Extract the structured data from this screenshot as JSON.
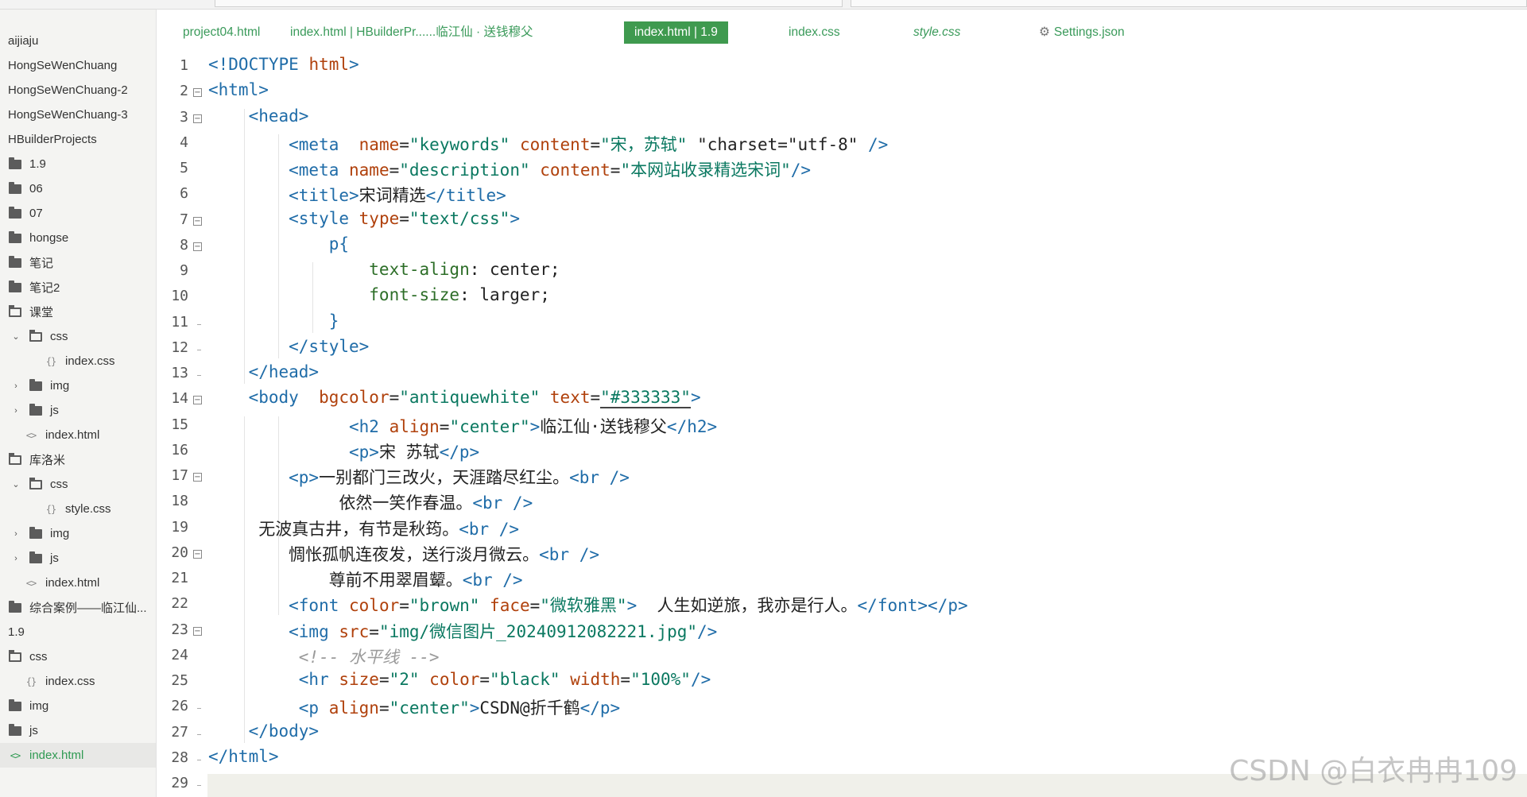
{
  "sidebar": {
    "items": [
      {
        "label": "aijiaju",
        "kind": "none",
        "chev": ""
      },
      {
        "label": "HongSeWenChuang",
        "kind": "none",
        "chev": ""
      },
      {
        "label": "HongSeWenChuang-2",
        "kind": "none",
        "chev": ""
      },
      {
        "label": "HongSeWenChuang-3",
        "kind": "none",
        "chev": ""
      },
      {
        "label": "HBuilderProjects",
        "kind": "none",
        "chev": ""
      },
      {
        "label": "1.9",
        "kind": "folder",
        "chev": ""
      },
      {
        "label": "06",
        "kind": "folder",
        "chev": ""
      },
      {
        "label": "07",
        "kind": "folder",
        "chev": ""
      },
      {
        "label": "hongse",
        "kind": "folder",
        "chev": ""
      },
      {
        "label": "笔记",
        "kind": "folder",
        "chev": ""
      },
      {
        "label": "笔记2",
        "kind": "folder",
        "chev": ""
      },
      {
        "label": "课堂",
        "kind": "folder-open",
        "chev": ""
      },
      {
        "label": "css",
        "kind": "folder-open",
        "chev": "v"
      },
      {
        "label": "index.css",
        "kind": "css",
        "chev": ""
      },
      {
        "label": "img",
        "kind": "folder",
        "chev": ">"
      },
      {
        "label": "js",
        "kind": "folder",
        "chev": ">"
      },
      {
        "label": "index.html",
        "kind": "html",
        "chev": ""
      },
      {
        "label": "库洛米",
        "kind": "folder-open",
        "chev": ""
      },
      {
        "label": "css",
        "kind": "folder-open",
        "chev": "v"
      },
      {
        "label": "style.css",
        "kind": "css",
        "chev": ""
      },
      {
        "label": "img",
        "kind": "folder",
        "chev": ">"
      },
      {
        "label": "js",
        "kind": "folder",
        "chev": ">"
      },
      {
        "label": "index.html",
        "kind": "html",
        "chev": ""
      },
      {
        "label": "综合案例——临江仙...",
        "kind": "folder",
        "chev": ""
      },
      {
        "label": "1.9",
        "kind": "none",
        "chev": ""
      },
      {
        "label": "css",
        "kind": "folder-open",
        "chev": ""
      },
      {
        "label": "index.css",
        "kind": "css",
        "chev": ""
      },
      {
        "label": "img",
        "kind": "folder",
        "chev": ""
      },
      {
        "label": "js",
        "kind": "folder",
        "chev": ""
      },
      {
        "label": "index.html",
        "kind": "html",
        "chev": "",
        "active": true
      }
    ]
  },
  "tabs": [
    {
      "label": "project04.html",
      "active": false
    },
    {
      "label": "index.html | HBuilderPr......临江仙 · 送钱穆父",
      "active": false
    },
    {
      "label": "index.html | 1.9",
      "active": true
    },
    {
      "label": "index.css",
      "active": false
    },
    {
      "label": "style.css",
      "active": false,
      "italic": true
    },
    {
      "label": "Settings.json",
      "active": false,
      "icon": "gear-icon"
    }
  ],
  "editor": {
    "line_numbers": [
      "1",
      "2",
      "3",
      "4",
      "5",
      "6",
      "7",
      "8",
      "9",
      "10",
      "11",
      "12",
      "13",
      "14",
      "15",
      "16",
      "17",
      "18",
      "19",
      "20",
      "21",
      "22",
      "23",
      "24",
      "25",
      "26",
      "27",
      "28",
      "29"
    ],
    "code": [
      [
        {
          "t": "<!DOCTYPE ",
          "c": "tag"
        },
        {
          "t": "html",
          "c": "doctype"
        },
        {
          "t": ">",
          "c": "tag"
        }
      ],
      [
        {
          "t": "<html>",
          "c": "tag"
        }
      ],
      [
        {
          "t": "    <head>",
          "c": "tag"
        }
      ],
      [
        {
          "t": "        <meta",
          "c": "tag"
        },
        {
          "t": "  name",
          "c": "attr"
        },
        {
          "t": "=",
          "c": "txt"
        },
        {
          "t": "\"keywords\"",
          "c": "str"
        },
        {
          "t": " content",
          "c": "attr"
        },
        {
          "t": "=",
          "c": "txt"
        },
        {
          "t": "\"宋，苏轼\"",
          "c": "str"
        },
        {
          "t": " \"charset=\"utf-8\"",
          "c": "txt"
        },
        {
          "t": " />",
          "c": "tag"
        }
      ],
      [
        {
          "t": "        <meta",
          "c": "tag"
        },
        {
          "t": " name",
          "c": "attr"
        },
        {
          "t": "=",
          "c": "txt"
        },
        {
          "t": "\"description\"",
          "c": "str"
        },
        {
          "t": " content",
          "c": "attr"
        },
        {
          "t": "=",
          "c": "txt"
        },
        {
          "t": "\"本网站收录精选宋词\"",
          "c": "str"
        },
        {
          "t": "/>",
          "c": "tag"
        }
      ],
      [
        {
          "t": "        <title>",
          "c": "tag"
        },
        {
          "t": "宋词精选",
          "c": "txt"
        },
        {
          "t": "</title>",
          "c": "tag"
        }
      ],
      [
        {
          "t": "        <style",
          "c": "tag"
        },
        {
          "t": " type",
          "c": "attr"
        },
        {
          "t": "=",
          "c": "txt"
        },
        {
          "t": "\"text/css\"",
          "c": "str"
        },
        {
          "t": ">",
          "c": "tag"
        }
      ],
      [
        {
          "t": "            p{",
          "c": "tag"
        }
      ],
      [
        {
          "t": "                text-align",
          "c": "prop"
        },
        {
          "t": ": center;",
          "c": "txt"
        }
      ],
      [
        {
          "t": "                font-size",
          "c": "prop"
        },
        {
          "t": ": larger;",
          "c": "txt"
        }
      ],
      [
        {
          "t": "            }",
          "c": "tag"
        }
      ],
      [
        {
          "t": "        </style>",
          "c": "tag"
        }
      ],
      [
        {
          "t": "    </head>",
          "c": "tag"
        }
      ],
      [
        {
          "t": "    <body",
          "c": "tag"
        },
        {
          "t": "  bgcolor",
          "c": "attr"
        },
        {
          "t": "=",
          "c": "txt"
        },
        {
          "t": "\"antiquewhite\"",
          "c": "str"
        },
        {
          "t": " text",
          "c": "attr"
        },
        {
          "t": "=",
          "c": "txt"
        },
        {
          "t": "\"#333333\"",
          "c": "str",
          "u": true
        },
        {
          "t": ">",
          "c": "tag"
        }
      ],
      [
        {
          "t": "              <h2",
          "c": "tag"
        },
        {
          "t": " align",
          "c": "attr"
        },
        {
          "t": "=",
          "c": "txt"
        },
        {
          "t": "\"center\"",
          "c": "str"
        },
        {
          "t": ">",
          "c": "tag"
        },
        {
          "t": "临江仙·送钱穆父",
          "c": "txt"
        },
        {
          "t": "</h2>",
          "c": "tag"
        }
      ],
      [
        {
          "t": "              <p>",
          "c": "tag"
        },
        {
          "t": "宋 苏轼",
          "c": "txt"
        },
        {
          "t": "</p>",
          "c": "tag"
        }
      ],
      [
        {
          "t": "        <p>",
          "c": "tag"
        },
        {
          "t": "一别都门三改火，天涯踏尽红尘。",
          "c": "txt"
        },
        {
          "t": "<br />",
          "c": "tag"
        }
      ],
      [
        {
          "t": "             依然一笑作春温。",
          "c": "txt"
        },
        {
          "t": "<br />",
          "c": "tag"
        }
      ],
      [
        {
          "t": "     无波真古井，有节是秋筠。",
          "c": "txt"
        },
        {
          "t": "<br />",
          "c": "tag"
        }
      ],
      [
        {
          "t": "        惆怅孤帆连夜发，送行淡月微云。",
          "c": "txt"
        },
        {
          "t": "<br />",
          "c": "tag"
        }
      ],
      [
        {
          "t": "            尊前不用翠眉颦。",
          "c": "txt"
        },
        {
          "t": "<br />",
          "c": "tag"
        }
      ],
      [
        {
          "t": "        <font",
          "c": "tag"
        },
        {
          "t": " color",
          "c": "attr"
        },
        {
          "t": "=",
          "c": "txt"
        },
        {
          "t": "\"brown\"",
          "c": "str"
        },
        {
          "t": " face",
          "c": "attr"
        },
        {
          "t": "=",
          "c": "txt"
        },
        {
          "t": "\"微软雅黑\"",
          "c": "str"
        },
        {
          "t": ">",
          "c": "tag"
        },
        {
          "t": "  人生如逆旅，我亦是行人。",
          "c": "txt"
        },
        {
          "t": "</font></p>",
          "c": "tag"
        }
      ],
      [
        {
          "t": "        <img",
          "c": "tag"
        },
        {
          "t": " src",
          "c": "attr"
        },
        {
          "t": "=",
          "c": "txt"
        },
        {
          "t": "\"img/微信图片_20240912082221.jpg\"",
          "c": "str"
        },
        {
          "t": "/>",
          "c": "tag"
        }
      ],
      [
        {
          "t": "         <!-- 水平线 -->",
          "c": "cmt"
        }
      ],
      [
        {
          "t": "         <hr",
          "c": "tag"
        },
        {
          "t": " size",
          "c": "attr"
        },
        {
          "t": "=",
          "c": "txt"
        },
        {
          "t": "\"2\"",
          "c": "str"
        },
        {
          "t": " color",
          "c": "attr"
        },
        {
          "t": "=",
          "c": "txt"
        },
        {
          "t": "\"black\"",
          "c": "str"
        },
        {
          "t": " width",
          "c": "attr"
        },
        {
          "t": "=",
          "c": "txt"
        },
        {
          "t": "\"100%\"",
          "c": "str"
        },
        {
          "t": "/>",
          "c": "tag"
        }
      ],
      [
        {
          "t": "         <p",
          "c": "tag"
        },
        {
          "t": " align",
          "c": "attr"
        },
        {
          "t": "=",
          "c": "txt"
        },
        {
          "t": "\"center\"",
          "c": "str"
        },
        {
          "t": ">",
          "c": "tag"
        },
        {
          "t": "CSDN@折千鹤",
          "c": "txt"
        },
        {
          "t": "</p>",
          "c": "tag"
        }
      ],
      [
        {
          "t": "    </body>",
          "c": "tag"
        }
      ],
      [
        {
          "t": "</html>",
          "c": "tag"
        }
      ],
      []
    ]
  },
  "watermark": "CSDN @白衣冉冉109"
}
